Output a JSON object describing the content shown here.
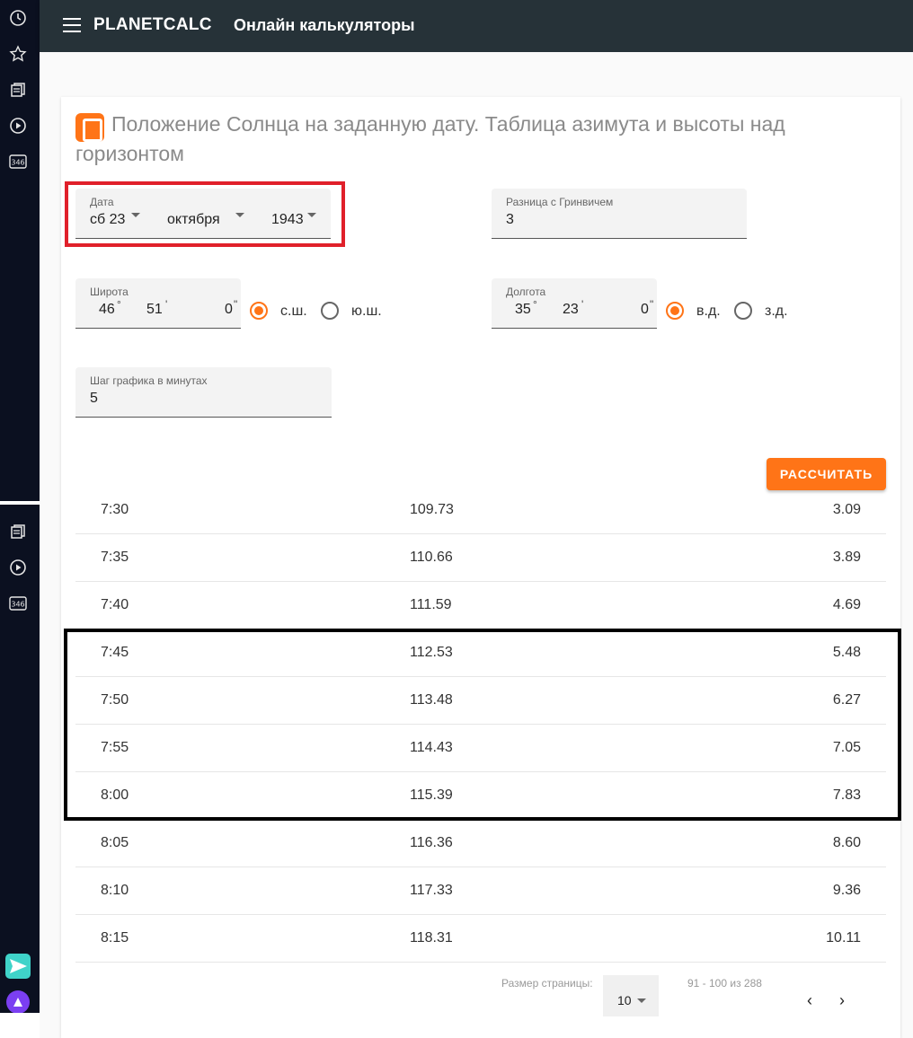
{
  "header": {
    "brand": "PLANETCALC",
    "subtitle": "Онлайн калькуляторы"
  },
  "sidebar": {
    "top_icons": [
      "clock-icon",
      "star-icon",
      "documents-icon",
      "play-icon",
      "calculator-346-icon"
    ],
    "bottom_icons": [
      "documents-icon",
      "play-icon",
      "calculator-346-icon",
      "send-app-icon",
      "assistant-app-icon"
    ],
    "badge_text": "346"
  },
  "calculator": {
    "title": "Положение Солнца на заданную дату. Таблица азимута и высоты над горизонтом",
    "date": {
      "label": "Дата",
      "day": "сб 23",
      "month": "октября",
      "year": "1943"
    },
    "gmt": {
      "label": "Разница с Гринвичем",
      "value": "3"
    },
    "latitude": {
      "label": "Широта",
      "deg": "46",
      "min": "51",
      "sec": "0",
      "north": "с.ш.",
      "south": "ю.ш.",
      "selected": "north"
    },
    "longitude": {
      "label": "Долгота",
      "deg": "35",
      "min": "23",
      "sec": "0",
      "east": "в.д.",
      "west": "з.д.",
      "selected": "east"
    },
    "step": {
      "label": "Шаг графика в минутах",
      "value": "5"
    },
    "calculate_label": "РАССЧИТАТЬ"
  },
  "table": {
    "rows": [
      {
        "time": "7:30",
        "azimuth": "109.73",
        "altitude": "3.09"
      },
      {
        "time": "7:35",
        "azimuth": "110.66",
        "altitude": "3.89"
      },
      {
        "time": "7:40",
        "azimuth": "111.59",
        "altitude": "4.69"
      },
      {
        "time": "7:45",
        "azimuth": "112.53",
        "altitude": "5.48"
      },
      {
        "time": "7:50",
        "azimuth": "113.48",
        "altitude": "6.27"
      },
      {
        "time": "7:55",
        "azimuth": "114.43",
        "altitude": "7.05"
      },
      {
        "time": "8:00",
        "azimuth": "115.39",
        "altitude": "7.83"
      },
      {
        "time": "8:05",
        "azimuth": "116.36",
        "altitude": "8.60"
      },
      {
        "time": "8:10",
        "azimuth": "117.33",
        "altitude": "9.36"
      },
      {
        "time": "8:15",
        "azimuth": "118.31",
        "altitude": "10.11"
      }
    ]
  },
  "pagination": {
    "page_size_label": "Размер страницы:",
    "page_size": "10",
    "range": "91 - 100 из 288",
    "prev": "‹",
    "next": "›"
  }
}
